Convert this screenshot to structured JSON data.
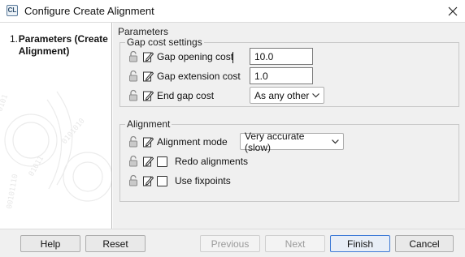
{
  "window": {
    "title": "Configure Create Alignment",
    "app_icon_text": "CL"
  },
  "sidebar": {
    "steps": [
      {
        "number": "1.",
        "label": "Parameters (Create Alignment)"
      }
    ]
  },
  "main": {
    "section_title": "Parameters",
    "gap_group": {
      "title": "Gap cost settings",
      "gap_opening_label": "Gap opening cost",
      "gap_opening_value": "10.0",
      "gap_extension_label": "Gap extension cost",
      "gap_extension_value": "1.0",
      "end_gap_label": "End gap cost",
      "end_gap_value": "As any other"
    },
    "alignment_group": {
      "title": "Alignment",
      "mode_label": "Alignment mode",
      "mode_value": "Very accurate (slow)",
      "redo_label": "Redo alignments",
      "redo_checked": false,
      "fixpoints_label": "Use fixpoints",
      "fixpoints_checked": false
    }
  },
  "footer": {
    "help": "Help",
    "reset": "Reset",
    "previous": "Previous",
    "next": "Next",
    "finish": "Finish",
    "cancel": "Cancel"
  },
  "colors": {
    "panel_bg": "#f0f0f0",
    "primary_border": "#3d7ad6",
    "disabled_text": "#9a9a9a"
  }
}
